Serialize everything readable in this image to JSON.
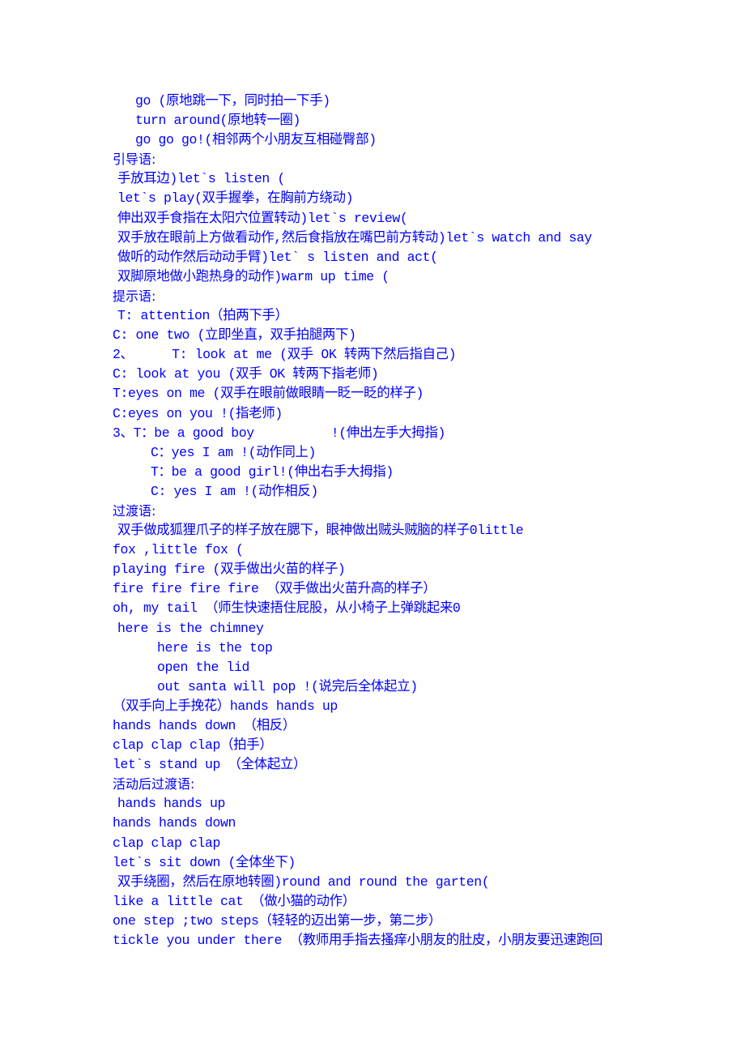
{
  "document": {
    "lines": [
      {
        "text": "go (原地跳一下，同时拍一下手)",
        "indent": 2
      },
      {
        "text": "turn around(原地转一圈)",
        "indent": 2
      },
      {
        "text": "go go go!(相邻两个小朋友互相碰臀部)",
        "indent": 2
      },
      {
        "text": "引导语:",
        "indent": 0,
        "heading": true
      },
      {
        "text": "手放耳边)let`s listen (",
        "indent": 1
      },
      {
        "text": "let`s play(双手握拳，在胸前方绕动)",
        "indent": 1
      },
      {
        "text": "伸出双手食指在太阳穴位置转动)let`s review(",
        "indent": 1
      },
      {
        "text": "双手放在眼前上方做看动作,然后食指放在嘴巴前方转动)let`s watch and say",
        "indent": 1
      },
      {
        "text": "做听的动作然后动动手臂)let` s listen and act(",
        "indent": 1
      },
      {
        "text": "双脚原地做小跑热身的动作)warm up time (",
        "indent": 1
      },
      {
        "text": "提示语:",
        "indent": 0,
        "heading": true
      },
      {
        "text": "T: attention（拍两下手）",
        "indent": 1
      },
      {
        "text": "C: one two (立即坐直，双手拍腿两下)",
        "indent": 0
      },
      {
        "text": "2、     T: look at me (双手 OK 转两下然后指自己)",
        "indent": 0
      },
      {
        "text": "C: look at you (双手 OK 转两下指老师)",
        "indent": 0
      },
      {
        "text": "T:eyes on me (双手在眼前做眼睛一眨一眨的样子)",
        "indent": 0
      },
      {
        "text": "C:eyes on you !(指老师)",
        "indent": 0
      },
      {
        "text": "3、T：be a good boy          !(伸出左手大拇指)",
        "indent": 0
      },
      {
        "text": "C：yes I am !(动作同上)",
        "indent": 3
      },
      {
        "text": "T：be a good girl!(伸出右手大拇指)",
        "indent": 3
      },
      {
        "text": "C: yes I am !(动作相反)",
        "indent": 3
      },
      {
        "text": "过渡语:",
        "indent": 0,
        "heading": true
      },
      {
        "text": "双手做成狐狸爪子的样子放在腮下，眼神做出贼头贼脑的样子0little",
        "indent": 1
      },
      {
        "text": "fox ,little fox (",
        "indent": 0
      },
      {
        "text": "playing fire (双手做出火苗的样子)",
        "indent": 0
      },
      {
        "text": "fire fire fire fire （双手做出火苗升高的样子）",
        "indent": 0
      },
      {
        "text": "oh, my tail （师生快速捂住屁股，从小椅子上弹跳起来0",
        "indent": 0
      },
      {
        "text": "here is the chimney",
        "indent": 1
      },
      {
        "text": "here is the top",
        "indent": 4
      },
      {
        "text": "open the lid",
        "indent": 4
      },
      {
        "text": "out santa will pop !(说完后全体起立)",
        "indent": 4
      },
      {
        "text": "（双手向上手挽花）hands hands up",
        "indent": 0
      },
      {
        "text": "hands hands down （相反）",
        "indent": 0
      },
      {
        "text": "clap clap clap（拍手）",
        "indent": 0
      },
      {
        "text": "let`s stand up （全体起立）",
        "indent": 0
      },
      {
        "text": "活动后过渡语:",
        "indent": 0,
        "heading": true
      },
      {
        "text": "hands hands up",
        "indent": 1
      },
      {
        "text": "hands hands down",
        "indent": 0
      },
      {
        "text": "clap clap clap",
        "indent": 0
      },
      {
        "text": "let`s sit down (全体坐下)",
        "indent": 0
      },
      {
        "text": "双手绕圈，然后在原地转圈)round and round the garten(",
        "indent": 1
      },
      {
        "text": "like a little cat （做小猫的动作）",
        "indent": 0
      },
      {
        "text": "one step ;two steps（轻轻的迈出第一步，第二步）",
        "indent": 0
      },
      {
        "text": "tickle you under there （教师用手指去搔痒小朋友的肚皮，小朋友要迅速跑回",
        "indent": 0
      }
    ]
  },
  "colors": {
    "text": "#0000ff",
    "background": "#ffffff"
  }
}
